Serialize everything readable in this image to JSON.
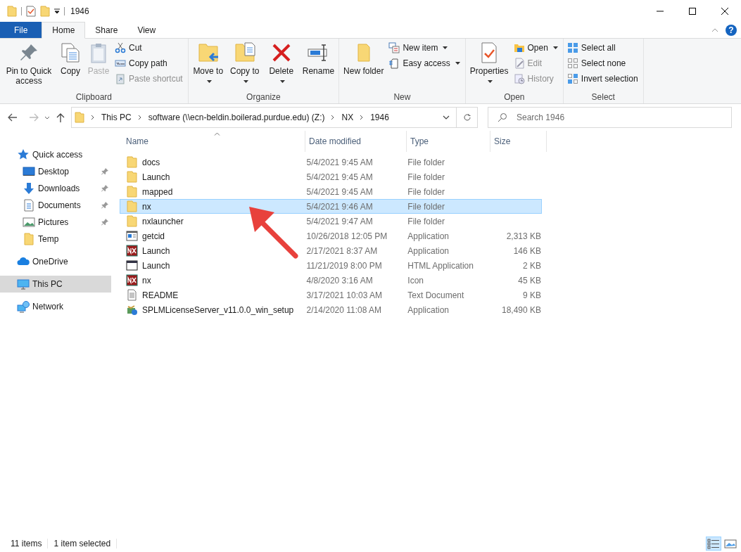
{
  "title_bar": {
    "title": "1946",
    "help_button": "?"
  },
  "ribbon_tabs": [
    {
      "label": "File",
      "kind": "file",
      "selected": false
    },
    {
      "label": "Home",
      "kind": "tab",
      "selected": true
    },
    {
      "label": "Share",
      "kind": "tab",
      "selected": false
    },
    {
      "label": "View",
      "kind": "tab",
      "selected": false
    }
  ],
  "ribbon_groups": [
    {
      "label": "Clipboard",
      "items": [
        {
          "label": "Pin to Quick access",
          "kind": "large",
          "disabled": false,
          "dropdown": false
        },
        {
          "label": "Copy",
          "kind": "large",
          "disabled": false,
          "dropdown": false
        },
        {
          "label": "Paste",
          "kind": "large",
          "disabled": true,
          "dropdown": false
        },
        {
          "label": "Cut",
          "kind": "small",
          "disabled": false,
          "dropdown": false
        },
        {
          "label": "Copy path",
          "kind": "small",
          "disabled": false,
          "dropdown": false
        },
        {
          "label": "Paste shortcut",
          "kind": "small",
          "disabled": true,
          "dropdown": false
        }
      ]
    },
    {
      "label": "Organize",
      "items": [
        {
          "label": "Move to",
          "kind": "large",
          "disabled": false,
          "dropdown": true
        },
        {
          "label": "Copy to",
          "kind": "large",
          "disabled": false,
          "dropdown": true
        },
        {
          "label": "Delete",
          "kind": "large",
          "disabled": false,
          "dropdown": true
        },
        {
          "label": "Rename",
          "kind": "large",
          "disabled": false,
          "dropdown": false
        }
      ]
    },
    {
      "label": "New",
      "items": [
        {
          "label": "New folder",
          "kind": "large",
          "disabled": false,
          "dropdown": false
        },
        {
          "label": "New item",
          "kind": "small",
          "disabled": false,
          "dropdown": true
        },
        {
          "label": "Easy access",
          "kind": "small",
          "disabled": false,
          "dropdown": true
        }
      ]
    },
    {
      "label": "Open",
      "items": [
        {
          "label": "Properties",
          "kind": "large",
          "disabled": false,
          "dropdown": true
        },
        {
          "label": "Open",
          "kind": "small",
          "disabled": false,
          "dropdown": true
        },
        {
          "label": "Edit",
          "kind": "small",
          "disabled": true,
          "dropdown": false
        },
        {
          "label": "History",
          "kind": "small",
          "disabled": true,
          "dropdown": false
        }
      ]
    },
    {
      "label": "Select",
      "items": [
        {
          "label": "Select all",
          "kind": "small",
          "disabled": false,
          "dropdown": false
        },
        {
          "label": "Select none",
          "kind": "small",
          "disabled": false,
          "dropdown": false
        },
        {
          "label": "Invert selection",
          "kind": "small",
          "disabled": false,
          "dropdown": false
        }
      ]
    }
  ],
  "address": {
    "path": [
      "This PC",
      "software (\\\\ecn-beldin.boilerad.purdue.edu) (Z:)",
      "NX",
      "1946"
    ],
    "search_placeholder": "Search 1946"
  },
  "navigation": [
    {
      "label": "Quick access",
      "kind": "quick",
      "selected": false,
      "children": [
        {
          "label": "Desktop",
          "kind": "desktop",
          "pinned": true,
          "selected": false
        },
        {
          "label": "Downloads",
          "kind": "downloads",
          "pinned": true,
          "selected": false
        },
        {
          "label": "Documents",
          "kind": "documents",
          "pinned": true,
          "selected": false
        },
        {
          "label": "Pictures",
          "kind": "pictures",
          "pinned": true,
          "selected": false
        },
        {
          "label": "Temp",
          "kind": "folder",
          "pinned": false,
          "selected": false
        }
      ]
    },
    {
      "label": "OneDrive",
      "kind": "cloud",
      "selected": false
    },
    {
      "label": "This PC",
      "kind": "pc",
      "selected": true
    },
    {
      "label": "Network",
      "kind": "network",
      "selected": false
    }
  ],
  "table": {
    "columns": [
      {
        "label": "Name",
        "sorted": true
      },
      {
        "label": "Date modified",
        "sorted": false
      },
      {
        "label": "Type",
        "sorted": false
      },
      {
        "label": "Size",
        "sorted": false
      }
    ],
    "rows": [
      {
        "name": "docs",
        "date": "5/4/2021 9:45 AM",
        "type": "File folder",
        "kind": "folder",
        "selected": false
      },
      {
        "name": "Launch",
        "date": "5/4/2021 9:45 AM",
        "type": "File folder",
        "kind": "folder",
        "selected": false
      },
      {
        "name": "mapped",
        "date": "5/4/2021 9:45 AM",
        "type": "File folder",
        "kind": "folder",
        "selected": false
      },
      {
        "name": "nx",
        "date": "5/4/2021 9:46 AM",
        "type": "File folder",
        "kind": "folder",
        "selected": true
      },
      {
        "name": "nxlauncher",
        "date": "5/4/2021 9:47 AM",
        "type": "File folder",
        "kind": "folder",
        "selected": false
      },
      {
        "name": "getcid",
        "date": "10/26/2018 12:05 PM",
        "type": "Application",
        "size": "2,313 KB",
        "kind": "app",
        "selected": false
      },
      {
        "name": "Launch",
        "date": "2/17/2021 8:37 AM",
        "type": "Application",
        "size": "146 KB",
        "kind": "nx",
        "selected": false
      },
      {
        "name": "Launch",
        "date": "11/21/2019 8:00 PM",
        "type": "HTML Application",
        "size": "2 KB",
        "kind": "html",
        "selected": false
      },
      {
        "name": "nx",
        "date": "4/8/2020 3:16 AM",
        "type": "Icon",
        "size": "45 KB",
        "kind": "nx",
        "selected": false
      },
      {
        "name": "README",
        "date": "3/17/2021 10:03 AM",
        "type": "Text Document",
        "size": "9 KB",
        "kind": "text",
        "selected": false
      },
      {
        "name": "SPLMLicenseServer_v11.0.0_win_setup",
        "date": "2/14/2020 11:08 AM",
        "type": "Application",
        "size": "18,490 KB",
        "kind": "setup",
        "selected": false
      }
    ]
  },
  "status_bar": {
    "item_count": "11 items",
    "selection": "1 item selected",
    "views": [
      {
        "kind": "details",
        "selected": true
      },
      {
        "kind": "tiles",
        "selected": false
      }
    ]
  }
}
